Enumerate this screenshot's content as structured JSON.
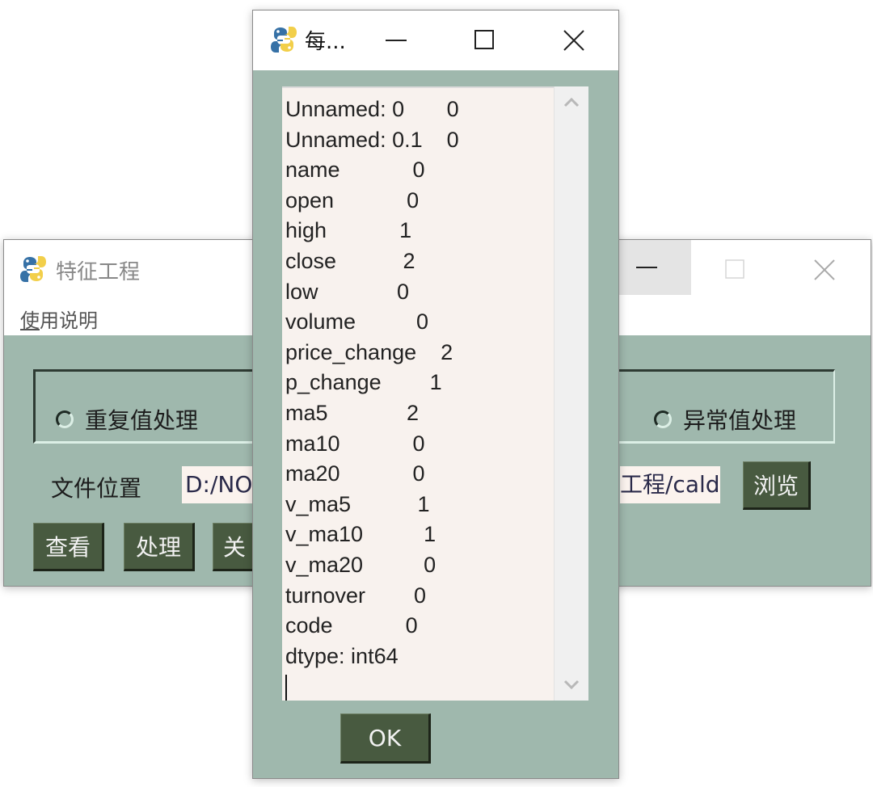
{
  "main_window": {
    "title": "特征工程",
    "menu": {
      "help_label": "使用说明",
      "help_mnemonic": "使",
      "help_rest": "用说明"
    },
    "radio_options": [
      {
        "label": "重复值处理",
        "selected": false
      },
      {
        "label": "异常值处理",
        "selected": false
      }
    ],
    "file_location_label": "文件位置",
    "file_path_value_start": "D:/NO",
    "file_path_value_end": "工程/caldle",
    "browse_button": "浏览",
    "buttons": {
      "view": "查看",
      "process": "处理",
      "close": "关"
    },
    "controls": {
      "minimize": "minimize",
      "maximize": "maximize",
      "close": "close"
    }
  },
  "dialog": {
    "title": "每...",
    "lines": [
      "Unnamed: 0       0",
      "Unnamed: 0.1    0",
      "name            0",
      "open            0",
      "high            1",
      "close           2",
      "low             0",
      "volume          0",
      "price_change    2",
      "p_change        1",
      "ma5             2",
      "ma10            0",
      "ma20            0",
      "v_ma5           1",
      "v_ma10          1",
      "v_ma20          0",
      "turnover        0",
      "code            0",
      "dtype: int64"
    ],
    "ok_button": "OK"
  },
  "colors": {
    "window_bg": "#9fb8ad",
    "button_bg": "#485a40",
    "text_area_bg": "#f8f2ee"
  }
}
